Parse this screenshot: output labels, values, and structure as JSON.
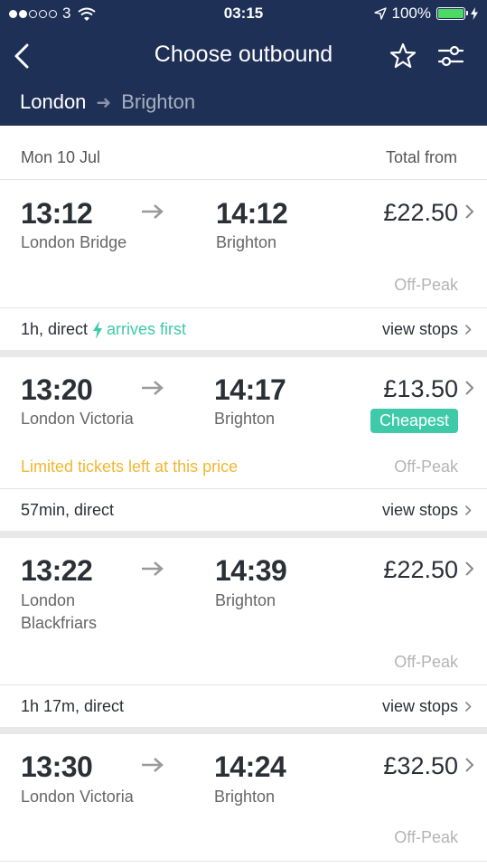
{
  "status_bar": {
    "carrier": "3",
    "time": "03:15",
    "battery": "100%",
    "battery_level": 1.0,
    "signal_bars_filled": 2
  },
  "header": {
    "title": "Choose outbound",
    "from": "London",
    "to": "Brighton",
    "bg_color": "#1f3057",
    "icons": [
      "back-icon",
      "star-icon",
      "filter-icon"
    ]
  },
  "list": {
    "date": "Mon 10 Jul",
    "total_label": "Total from"
  },
  "journeys": [
    {
      "depart": "13:12",
      "from": "London Bridge",
      "arrive": "14:12",
      "to": "Brighton",
      "price": "£22.50",
      "fare": "Off-Peak",
      "summary": "1h, direct",
      "tag": "arrives first",
      "view_stops": "view stops"
    },
    {
      "depart": "13:20",
      "from": "London Victoria",
      "arrive": "14:17",
      "to": "Brighton",
      "price": "£13.50",
      "badge": "Cheapest",
      "warning": "Limited tickets left at this price",
      "fare": "Off-Peak",
      "summary": "57min, direct",
      "view_stops": "view stops"
    },
    {
      "depart": "13:22",
      "from_line1": "London",
      "from_line2": "Blackfriars",
      "arrive": "14:39",
      "to": "Brighton",
      "price": "£22.50",
      "fare": "Off-Peak",
      "summary": "1h 17m, direct",
      "view_stops": "view stops"
    },
    {
      "depart": "13:30",
      "from": "London Victoria",
      "arrive": "14:24",
      "to": "Brighton",
      "price": "£32.50",
      "fare": "Off-Peak"
    }
  ],
  "colors": {
    "accent_green": "#3ecaa8",
    "warning": "#f4b531",
    "battery_fill": "#4cd964"
  }
}
